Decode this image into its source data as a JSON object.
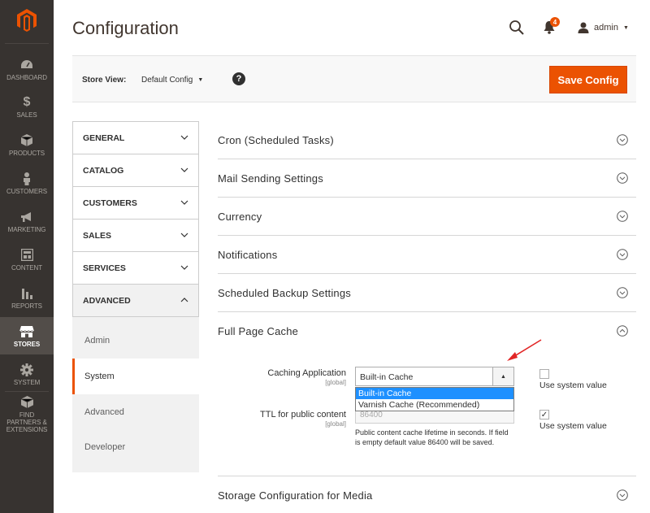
{
  "nav": {
    "items": [
      {
        "label": "DASHBOARD",
        "icon": "dashboard-icon"
      },
      {
        "label": "SALES",
        "icon": "dollar-icon"
      },
      {
        "label": "PRODUCTS",
        "icon": "cube-icon"
      },
      {
        "label": "CUSTOMERS",
        "icon": "person-icon"
      },
      {
        "label": "MARKETING",
        "icon": "megaphone-icon"
      },
      {
        "label": "CONTENT",
        "icon": "layout-icon"
      },
      {
        "label": "REPORTS",
        "icon": "bar-chart-icon"
      },
      {
        "label": "STORES",
        "icon": "storefront-icon"
      },
      {
        "label": "SYSTEM",
        "icon": "gear-icon"
      },
      {
        "label": "FIND PARTNERS & EXTENSIONS",
        "icon": "box-icon"
      }
    ],
    "active": "STORES"
  },
  "header": {
    "title": "Configuration",
    "notification_count": "4",
    "user": "admin"
  },
  "store_bar": {
    "label": "Store View:",
    "value": "Default Config",
    "help": "?",
    "save_label": "Save Config"
  },
  "tabs": {
    "items": [
      {
        "label": "GENERAL"
      },
      {
        "label": "CATALOG"
      },
      {
        "label": "CUSTOMERS"
      },
      {
        "label": "SALES"
      },
      {
        "label": "SERVICES"
      },
      {
        "label": "ADVANCED"
      }
    ],
    "advanced_items": [
      {
        "label": "Admin"
      },
      {
        "label": "System"
      },
      {
        "label": "Advanced"
      },
      {
        "label": "Developer"
      }
    ],
    "active_sub": "System"
  },
  "sections": [
    {
      "title": "Cron (Scheduled Tasks)"
    },
    {
      "title": "Mail Sending Settings"
    },
    {
      "title": "Currency"
    },
    {
      "title": "Notifications"
    },
    {
      "title": "Scheduled Backup Settings"
    },
    {
      "title": "Full Page Cache"
    },
    {
      "title": "Storage Configuration for Media"
    }
  ],
  "full_page_cache": {
    "caching_application": {
      "label": "Caching Application",
      "scope": "[global]",
      "value": "Built-in Cache",
      "options": [
        "Built-in Cache",
        "Varnish Cache (Recommended)"
      ],
      "use_system_value": "Use system value",
      "use_system_checked": false
    },
    "ttl": {
      "label": "TTL for public content",
      "scope": "[global]",
      "value": "86400",
      "note": "Public content cache lifetime in seconds. If field is empty default value 86400 will be saved.",
      "use_system_value": "Use system value",
      "use_system_checked": true
    }
  },
  "colors": {
    "accent": "#eb5202",
    "nav_bg": "#373330",
    "selection": "#1e90ff",
    "annotation_arrow": "#e22626"
  }
}
